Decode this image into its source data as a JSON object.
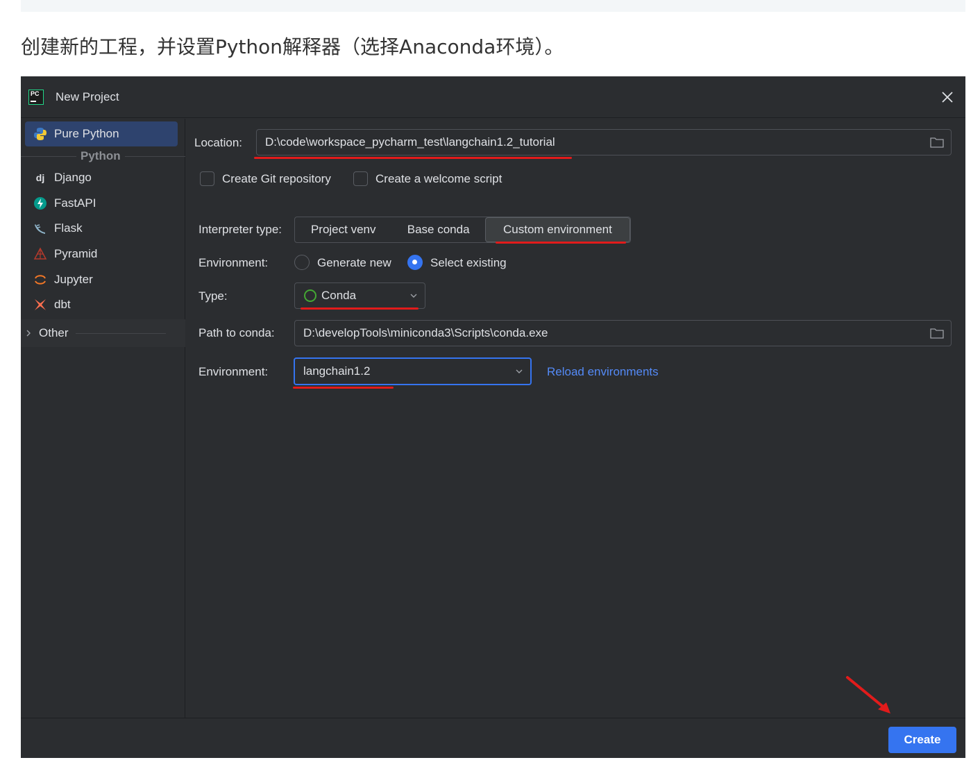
{
  "caption": "创建新的工程，并设置Python解释器（选择Anaconda环境）。",
  "dialog": {
    "title": "New Project",
    "app_icon_text": "PC"
  },
  "sidebar": {
    "selected": "Pure Python",
    "group_label": "Python",
    "items": [
      {
        "label": "Pure Python",
        "icon": "python-icon"
      },
      {
        "label": "Django",
        "icon": "django-icon",
        "glyph": "dj"
      },
      {
        "label": "FastAPI",
        "icon": "fastapi-icon"
      },
      {
        "label": "Flask",
        "icon": "flask-icon"
      },
      {
        "label": "Pyramid",
        "icon": "pyramid-icon"
      },
      {
        "label": "Jupyter",
        "icon": "jupyter-icon"
      },
      {
        "label": "dbt",
        "icon": "dbt-icon"
      }
    ],
    "other_label": "Other"
  },
  "form": {
    "location_label": "Location:",
    "location_value": "D:\\code\\workspace_pycharm_test\\langchain1.2_tutorial",
    "create_git_label": "Create Git repository",
    "create_git_checked": false,
    "welcome_script_label": "Create a welcome script",
    "welcome_script_checked": false,
    "interpreter_type_label": "Interpreter type:",
    "interpreter_types": [
      "Project venv",
      "Base conda",
      "Custom environment"
    ],
    "interpreter_type_selected": "Custom environment",
    "environment_mode_label": "Environment:",
    "generate_new_label": "Generate new",
    "select_existing_label": "Select existing",
    "environment_mode_selected": "Select existing",
    "type_label": "Type:",
    "type_value": "Conda",
    "path_to_conda_label": "Path to conda:",
    "path_to_conda_value": "D:\\developTools\\miniconda3\\Scripts\\conda.exe",
    "environment_label": "Environment:",
    "environment_value": "langchain1.2",
    "reload_label": "Reload environments"
  },
  "footer": {
    "create_label": "Create"
  },
  "colors": {
    "background": "#2b2d30",
    "accent": "#3574f0",
    "link": "#548af7",
    "annotation_red": "#e21b1b"
  }
}
